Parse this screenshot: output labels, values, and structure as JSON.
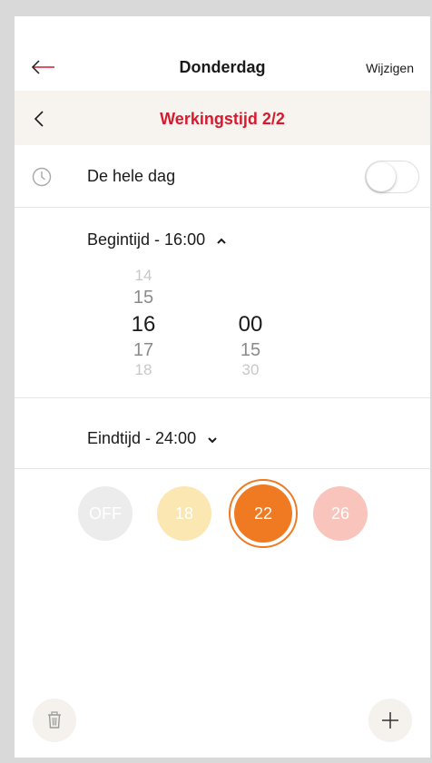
{
  "header": {
    "title": "Donderdag",
    "edit_label": "Wijzigen"
  },
  "subheader": {
    "title": "Werkingstijd 2/2"
  },
  "all_day": {
    "label": "De hele dag",
    "enabled": false
  },
  "start_time": {
    "label": "Begintijd  - 16:00",
    "hours": [
      "14",
      "15",
      "16",
      "17",
      "18"
    ],
    "minutes": [
      "00",
      "15",
      "30"
    ],
    "selected_hour": "16",
    "selected_minute": "00"
  },
  "end_time": {
    "label": "Eindtijd  - 24:00"
  },
  "temperatures": [
    {
      "label": "OFF",
      "color": "#ececec",
      "selected": false
    },
    {
      "label": "18",
      "color": "#fbe7b2",
      "selected": false
    },
    {
      "label": "22",
      "color": "#f07a22",
      "selected": true
    },
    {
      "label": "26",
      "color": "#f8c4bb",
      "selected": false
    }
  ],
  "icons": {
    "back": "back-arrow-icon",
    "sub_back": "chevron-left-icon",
    "clock": "clock-icon",
    "expand": "chevron-up-icon",
    "collapse": "chevron-down-icon",
    "delete": "trash-icon",
    "add": "plus-icon"
  },
  "colors": {
    "accent": "#d71a2f",
    "selected_temp": "#f07a22",
    "subheader_bg": "#f7f3ee"
  }
}
